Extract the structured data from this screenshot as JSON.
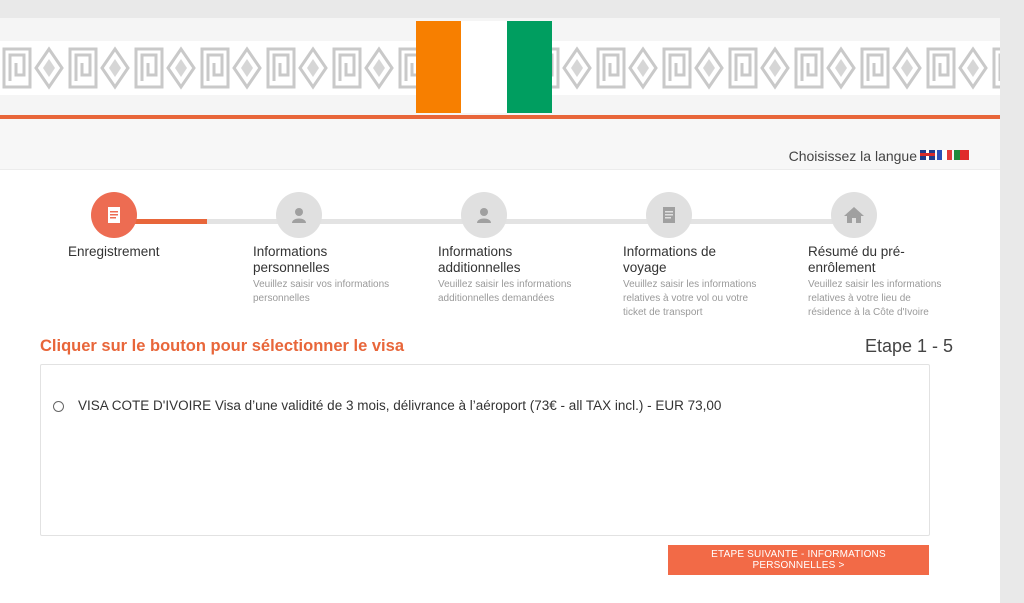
{
  "header": {
    "flag_colors": [
      "#f77f00",
      "#ffffff",
      "#009e60"
    ],
    "accent_color": "#e8663a"
  },
  "language": {
    "label": "Choisissez la langue",
    "flags": [
      "flag-en-icon",
      "flag-fr-icon",
      "flag-pt-icon"
    ]
  },
  "steps": [
    {
      "title": "Enregistrement",
      "desc": "",
      "icon": "document-icon",
      "active": true
    },
    {
      "title": "Informations personnelles",
      "desc": "Veuillez saisir vos informations personnelles",
      "icon": "person-icon",
      "active": false
    },
    {
      "title": "Informations additionnelles",
      "desc": "Veuillez saisir les informations additionnelles demandées",
      "icon": "person-icon",
      "active": false
    },
    {
      "title": "Informations de voyage",
      "desc": "Veuillez saisir les informations relatives à votre vol ou votre ticket de transport",
      "icon": "document-icon",
      "active": false
    },
    {
      "title": "Résumé du pré-enrôlement",
      "desc": "Veuillez saisir les informations relatives à votre lieu de résidence à la Côte d'Ivoire",
      "icon": "home-icon",
      "active": false
    }
  ],
  "main": {
    "title": "Cliquer sur le bouton pour sélectionner le visa",
    "step_counter": "Etape 1 - 5",
    "visa_option": "VISA COTE D'IVOIRE Visa d’une validité de 3 mois, délivrance à l’aéroport (73€ - all TAX incl.) - EUR 73,00",
    "next_button": "ETAPE SUIVANTE - INFORMATIONS PERSONNELLES >"
  }
}
